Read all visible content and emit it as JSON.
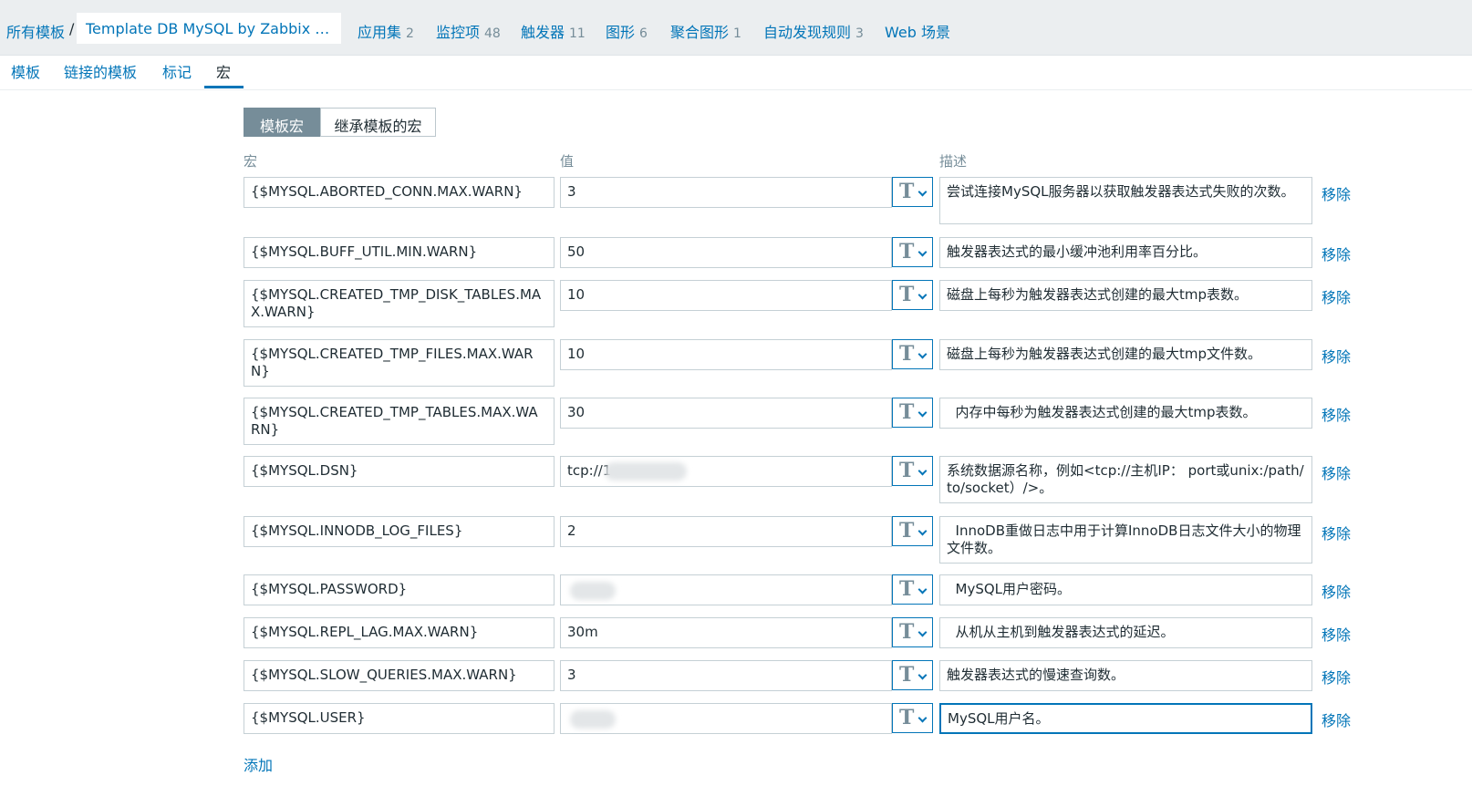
{
  "breadcrumb": {
    "all_templates": "所有模板",
    "separator": "/",
    "current": "Template DB MySQL by Zabbix agen...",
    "links": [
      {
        "label": "应用集",
        "count": "2"
      },
      {
        "label": "监控项",
        "count": "48"
      },
      {
        "label": "触发器",
        "count": "11"
      },
      {
        "label": "图形",
        "count": "6"
      },
      {
        "label": "聚合图形",
        "count": "1"
      },
      {
        "label": "自动发现规则",
        "count": "3"
      },
      {
        "label": "Web 场景",
        "count": ""
      }
    ]
  },
  "tabs": [
    {
      "label": "模板",
      "active": false
    },
    {
      "label": "链接的模板",
      "active": false
    },
    {
      "label": "标记",
      "active": false
    },
    {
      "label": "宏",
      "active": true
    }
  ],
  "macro_scope": {
    "template_macros": "模板宏",
    "inherited_macros": "继承模板的宏"
  },
  "columns": {
    "macro": "宏",
    "value": "值",
    "description": "描述"
  },
  "type_button": {
    "icon": "T",
    "icon_name": "text-type-icon"
  },
  "remove_label": "移除",
  "add_label": "添加",
  "rows": [
    {
      "macro": "{$MYSQL.ABORTED_CONN.MAX.WARN}",
      "value": "3",
      "description": "尝试连接MySQL服务器以获取触发器表达式失败的次数。"
    },
    {
      "macro": "{$MYSQL.BUFF_UTIL.MIN.WARN}",
      "value": "50",
      "description": "触发器表达式的最小缓冲池利用率百分比。"
    },
    {
      "macro": "{$MYSQL.CREATED_TMP_DISK_TABLES.MAX.WARN}",
      "value": "10",
      "description": "磁盘上每秒为触发器表达式创建的最大tmp表数。"
    },
    {
      "macro": "{$MYSQL.CREATED_TMP_FILES.MAX.WARN}",
      "value": "10",
      "description": "磁盘上每秒为触发器表达式创建的最大tmp文件数。"
    },
    {
      "macro": "{$MYSQL.CREATED_TMP_TABLES.MAX.WARN}",
      "value": "30",
      "description": "  内存中每秒为触发器表达式创建的最大tmp表数。"
    },
    {
      "macro": "{$MYSQL.DSN}",
      "value": "tcp://1",
      "description": "系统数据源名称，例如<tcp://主机IP： port或unix:/path/to/socket）/>。"
    },
    {
      "macro": "{$MYSQL.INNODB_LOG_FILES}",
      "value": "2",
      "description": "  InnoDB重做日志中用于计算InnoDB日志文件大小的物理文件数。"
    },
    {
      "macro": "{$MYSQL.PASSWORD}",
      "value": "",
      "description": "  MySQL用户密码。"
    },
    {
      "macro": "{$MYSQL.REPL_LAG.MAX.WARN}",
      "value": "30m",
      "description": "  从机从主机到触发器表达式的延迟。"
    },
    {
      "macro": "{$MYSQL.SLOW_QUERIES.MAX.WARN}",
      "value": "3",
      "description": "触发器表达式的慢速查询数。"
    },
    {
      "macro": "{$MYSQL.USER}",
      "value": "",
      "description": "MySQL用户名。"
    }
  ]
}
